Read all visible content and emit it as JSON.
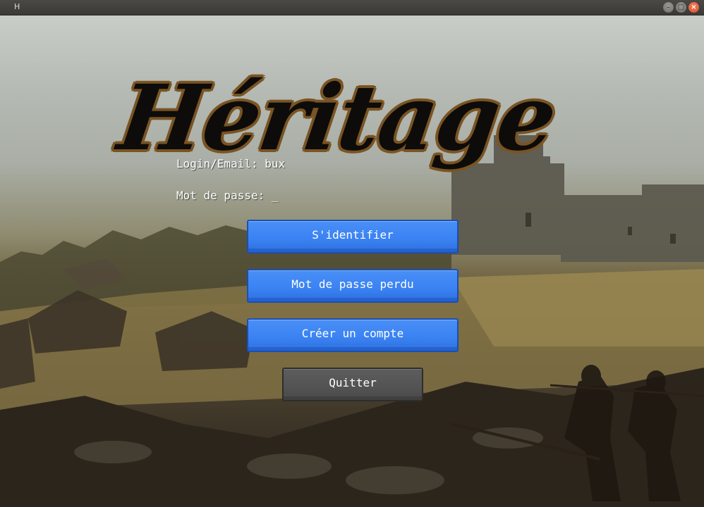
{
  "window": {
    "title": "H"
  },
  "logo": {
    "text": "Héritage"
  },
  "form": {
    "login_label": "Login/Email:",
    "login_value": "bux",
    "password_label": "Mot de passe:",
    "password_value": "_"
  },
  "buttons": {
    "login": "S'identifier",
    "lost_password": "Mot de passe perdu",
    "create_account": "Créer un compte",
    "quit": "Quitter"
  },
  "colors": {
    "primary_button": "#3b83f3",
    "secondary_button": "#545454",
    "logo_outline": "#7a5423"
  }
}
